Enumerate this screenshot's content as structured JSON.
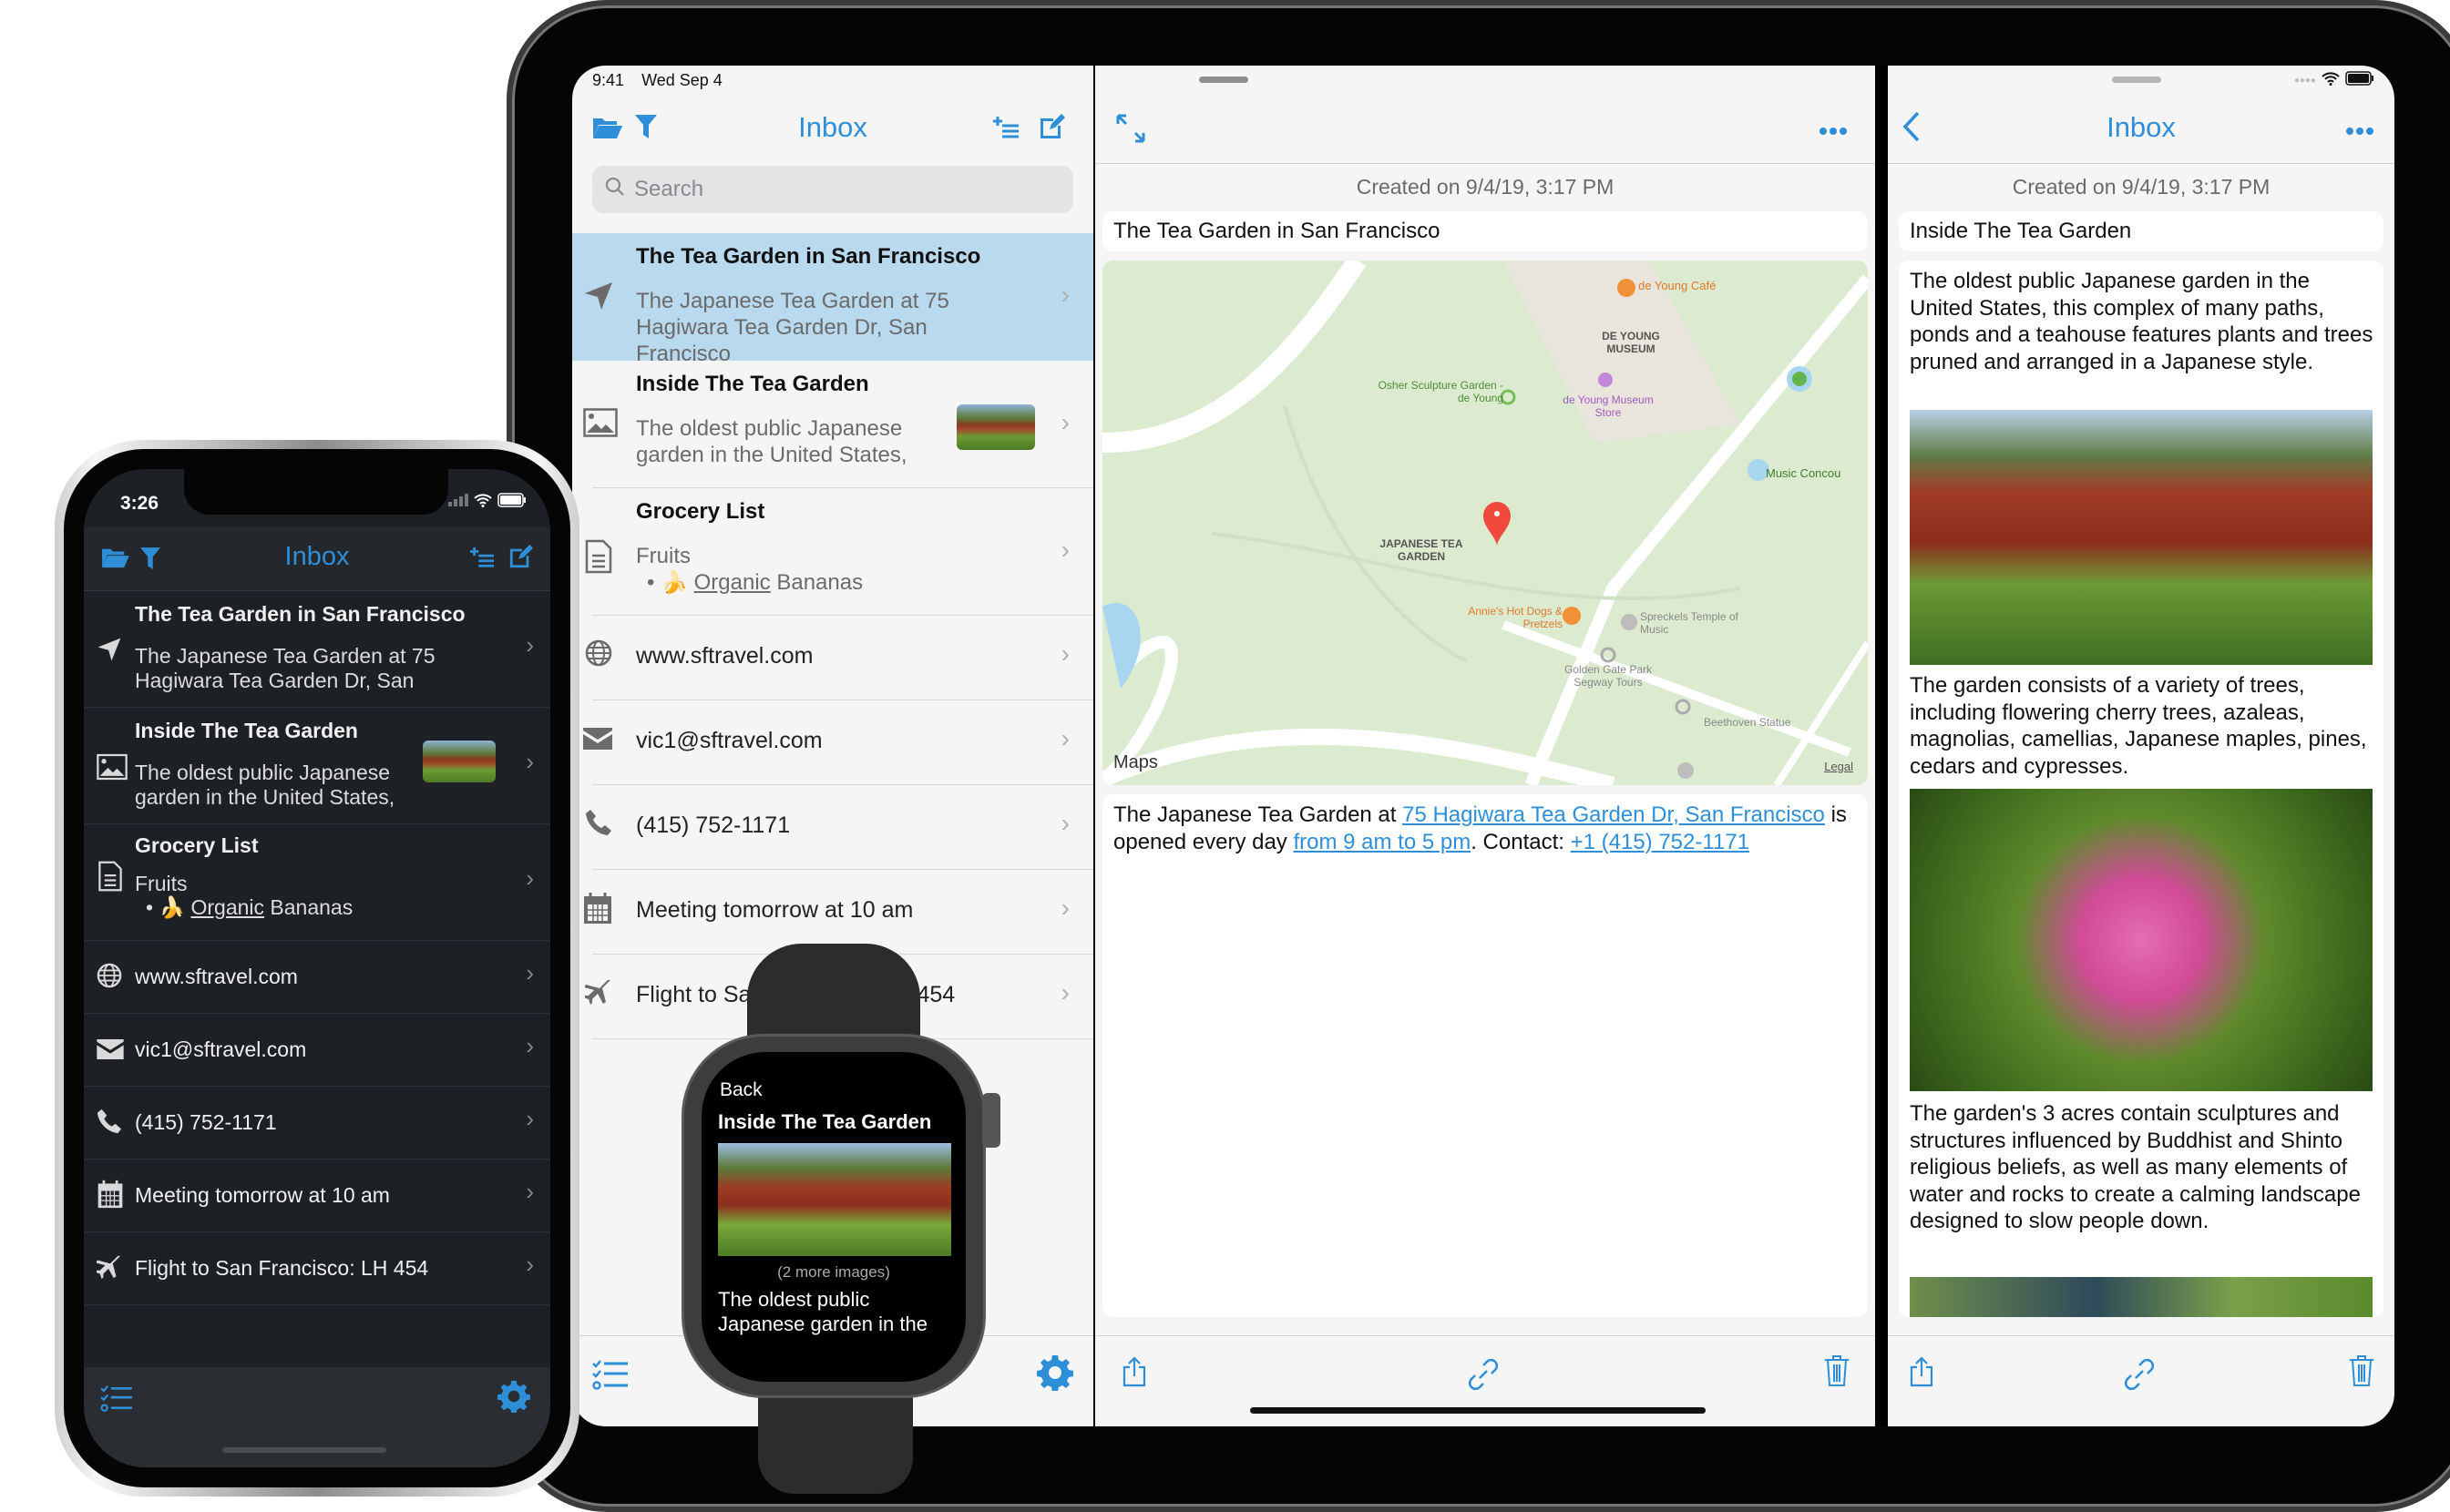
{
  "colors": {
    "accent": "#2e8fd8",
    "selected_row": "#b9d9ee",
    "pin": "#f04a3c"
  },
  "ipad": {
    "status": {
      "time": "9:41",
      "date": "Wed Sep 4"
    },
    "list": {
      "title": "Inbox",
      "icons": [
        "folder-open-icon",
        "filter-icon",
        "sort-list-icon",
        "compose-icon"
      ],
      "search_placeholder": "Search",
      "items": [
        {
          "title": "The Tea Garden in San Francisco",
          "subtitle": "The Japanese Tea Garden at 75 Hagiwara Tea Garden Dr, San Francisco",
          "icon": "location-arrow-icon",
          "selected": true
        },
        {
          "title": "Inside The Tea Garden",
          "subtitle": "The oldest public Japanese garden in the United States,",
          "icon": "image-icon",
          "has_thumbnail": true
        },
        {
          "title": "Grocery List",
          "subtitle": "Fruits",
          "bullet_emoji": "🍌",
          "bullet_link": "Organic",
          "bullet_rest": " Bananas",
          "icon": "document-icon"
        },
        {
          "text": "www.sftravel.com",
          "icon": "globe-icon"
        },
        {
          "text": "vic1@sftravel.com",
          "icon": "envelope-icon"
        },
        {
          "text": "(415) 752-1171",
          "icon": "phone-icon"
        },
        {
          "text": "Meeting tomorrow at 10 am",
          "icon": "calendar-icon"
        },
        {
          "text": "Flight to San Francisco: LH 454",
          "icon": "airplane-icon"
        }
      ]
    },
    "detail": {
      "created": "Created on 9/4/19, 3:17 PM",
      "title": "The Tea Garden in San Francisco",
      "map": {
        "labels": {
          "cafe": "de Young Café",
          "museum": "DE YOUNG MUSEUM",
          "sculpture": "Osher Sculpture Garden - de Young",
          "store": "de Young Museum Store",
          "music": "Music Concou",
          "garden": "JAPANESE TEA GARDEN",
          "hotdogs": "Annie's Hot Dogs & Pretzels",
          "spreckels": "Spreckels Temple of Music",
          "segway": "Golden Gate Park Segway Tours",
          "beethoven": "Beethoven Statue",
          "maps": "Maps",
          "legal": "Legal"
        }
      },
      "body_prefix": "The Japanese Tea Garden at ",
      "address_link": "75 Hagiwara Tea Garden Dr, San Francisco",
      "body_mid": " is opened every day ",
      "hours_link": "from 9 am to 5 pm",
      "body_contact": ". Contact: ",
      "phone_link": "+1 (415) 752-1171"
    },
    "right": {
      "title": "Inbox",
      "created": "Created on 9/4/19, 3:17 PM",
      "note_title": "Inside The Tea Garden",
      "para1": "The oldest public Japanese garden in the United States, this complex of many paths, ponds and a teahouse features plants and trees pruned and arranged in a Japanese style.",
      "para2": "The garden consists of a variety of trees, including flowering cherry trees, azaleas, magnolias, camellias, Japanese maples, pines, cedars and cypresses.",
      "para3": "The garden's 3 acres contain sculptures and structures influenced by Buddhist and Shinto religious beliefs, as well as many elements of water and rocks to create a calming landscape designed to slow people down."
    }
  },
  "iphone": {
    "status_time": "3:26",
    "title": "Inbox",
    "items": [
      {
        "title": "The Tea Garden in San Francisco",
        "subtitle": "The Japanese Tea Garden at 75 Hagiwara Tea Garden Dr, San"
      },
      {
        "title": "Inside The Tea Garden",
        "subtitle": "The oldest public Japanese garden in the United States,"
      },
      {
        "title": "Grocery List",
        "subtitle": "Fruits",
        "bullet_emoji": "🍌",
        "bullet_link": "Organic",
        "bullet_rest": " Bananas"
      },
      {
        "text": "www.sftravel.com"
      },
      {
        "text": "vic1@sftravel.com"
      },
      {
        "text": "(415) 752-1171"
      },
      {
        "text": "Meeting tomorrow at 10 am"
      },
      {
        "text": "Flight to San Francisco: LH 454"
      }
    ]
  },
  "watch": {
    "back": "Back",
    "title": "Inside The Tea Garden",
    "more_images": "(2 more images)",
    "body": "The oldest public Japanese garden in the"
  }
}
